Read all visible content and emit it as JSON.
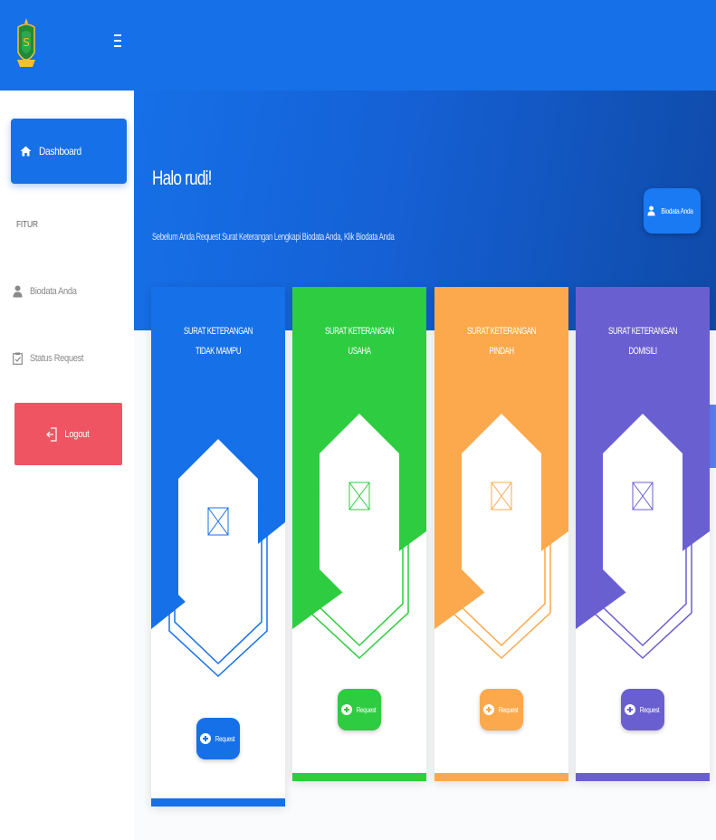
{
  "sidebar": {
    "menu_icon": "hamburger-menu-icon",
    "logo_icon": "emblem-logo",
    "dashboard_label": "Dashboard",
    "section_label": "FITUR",
    "items": [
      {
        "label": "Biodata Anda",
        "icon": "user-icon"
      },
      {
        "label": "Status Request",
        "icon": "clipboard-check-icon"
      }
    ],
    "logout_label": "Logout"
  },
  "hero": {
    "greeting": "Halo rudi!",
    "subtitle": "Sebelum Anda Request Surat Keterangan Lengkapi Biodata Anda, Klik Biodata Anda",
    "biodata_button": "Biodata Anda"
  },
  "cards": [
    {
      "title": "SURAT KETERANGAN TIDAK MAMPU",
      "button": "Request",
      "color": "#1670e8"
    },
    {
      "title": "SURAT KETERANGAN USAHA",
      "button": "Request",
      "color": "#2ecc40"
    },
    {
      "title": "SURAT KETERANGAN PINDAH",
      "button": "Request",
      "color": "#fba94c"
    },
    {
      "title": "SURAT KETERANGAN DOMISILI",
      "button": "Request",
      "color": "#6a5fd0"
    }
  ],
  "colors": {
    "primary": "#1670e8",
    "logout": "#ef5463"
  },
  "settings_icon": "gear-icon"
}
